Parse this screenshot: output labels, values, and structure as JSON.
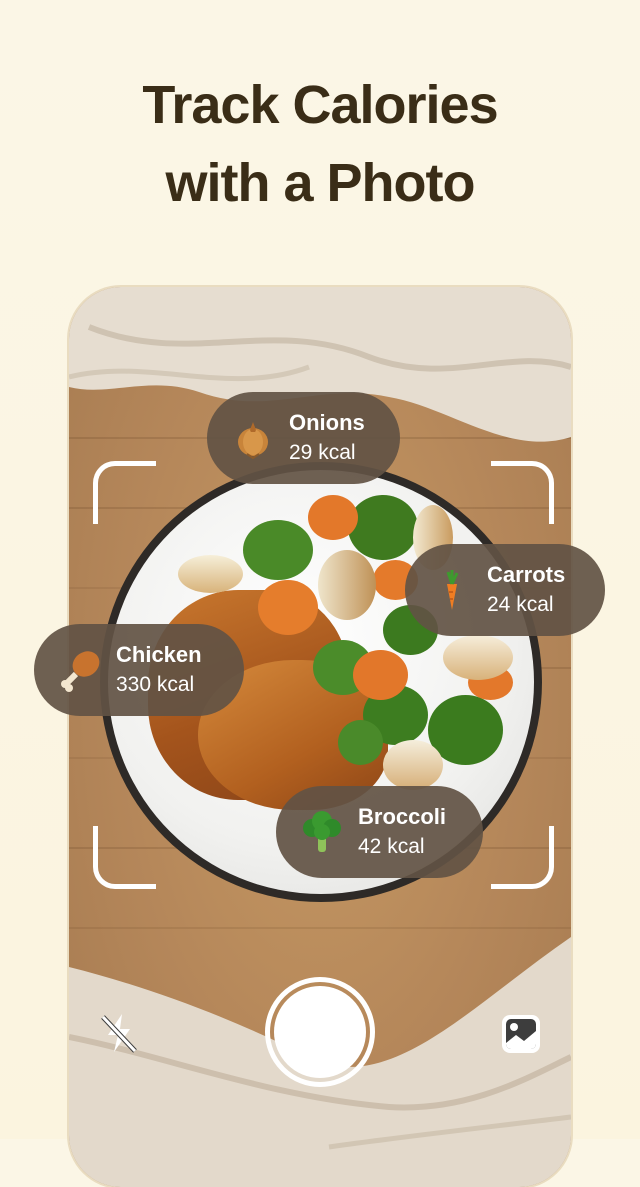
{
  "headline": {
    "line1": "Track Calories",
    "line2": "with a Photo"
  },
  "labels": [
    {
      "name": "Onions",
      "kcal": "29 kcal",
      "icon": "onion-icon"
    },
    {
      "name": "Carrots",
      "kcal": "24 kcal",
      "icon": "carrot-icon"
    },
    {
      "name": "Chicken",
      "kcal": "330 kcal",
      "icon": "chicken-leg-icon"
    },
    {
      "name": "Broccoli",
      "kcal": "42 kcal",
      "icon": "broccoli-icon"
    }
  ],
  "controls": {
    "flash": "flash-off-icon",
    "shutter": "shutter-button",
    "gallery": "gallery-icon"
  },
  "colors": {
    "background": "#fbf6e6",
    "headline": "#3a2d17",
    "pill": "#625244"
  }
}
